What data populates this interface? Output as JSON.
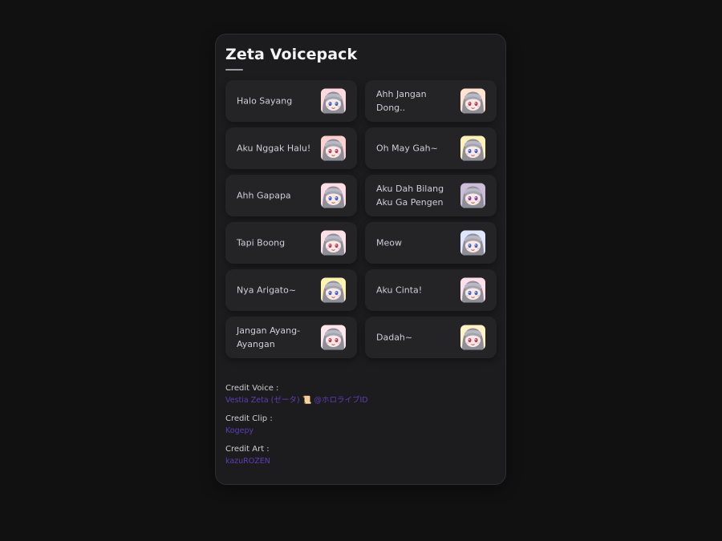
{
  "title": "Zeta Voicepack",
  "buttons": [
    {
      "label": "Halo Sayang",
      "icon": "zeta-smirk-icon"
    },
    {
      "label": "Ahh Jangan Dong..",
      "icon": "zeta-blush-icon"
    },
    {
      "label": "Aku Nggak Halu!",
      "icon": "zeta-shout-icon"
    },
    {
      "label": "Oh May Gah~",
      "icon": "zeta-shocked-icon"
    },
    {
      "label": "Ahh Gapapa",
      "icon": "zeta-cry-icon"
    },
    {
      "label": "Aku Dah Bilang Aku Ga Pengen",
      "icon": "zeta-dark-icon"
    },
    {
      "label": "Tapi Boong",
      "icon": "zeta-grin-icon"
    },
    {
      "label": "Meow",
      "icon": "zeta-cat-icon"
    },
    {
      "label": "Nya Arigato~",
      "icon": "zeta-wink-icon"
    },
    {
      "label": "Aku Cinta!",
      "icon": "zeta-love-icon"
    },
    {
      "label": "Jangan Ayang-Ayangan",
      "icon": "zeta-pout-icon"
    },
    {
      "label": "Dadah~",
      "icon": "zeta-wave-icon"
    }
  ],
  "credits": [
    {
      "label": "Credit Voice :",
      "value": "Vestia Zeta (ゼータ) 📜 @ホロライブID"
    },
    {
      "label": "Credit Clip :",
      "value": "Kogepy"
    },
    {
      "label": "Credit Art :",
      "value": "kazuROZEN"
    }
  ],
  "colors": {
    "background": "#111111",
    "panel": "#1c1c1e",
    "card": "#242427",
    "text": "#cfcfd3",
    "link": "#5a3fb5"
  }
}
